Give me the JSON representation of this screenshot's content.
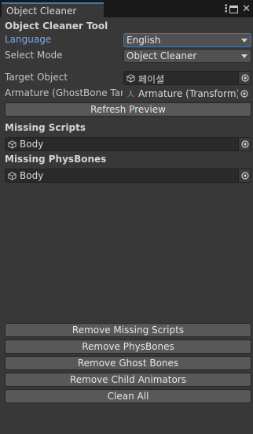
{
  "window": {
    "tab_title": "Object Cleaner",
    "icons": [
      "more-vertical-icon",
      "maximize-icon",
      "close-icon"
    ]
  },
  "header": {
    "title": "Object Cleaner Tool"
  },
  "language": {
    "label": "Language",
    "value": "English"
  },
  "mode": {
    "label": "Select Mode",
    "value": "Object Cleaner"
  },
  "target": {
    "label": "Target Object",
    "value": "페이셜"
  },
  "armature": {
    "label": "Armature (GhostBone Targ",
    "value": "Armature (Transform)"
  },
  "refresh_button": "Refresh Preview",
  "missing_scripts": {
    "title": "Missing Scripts",
    "items": [
      "Body"
    ]
  },
  "missing_physbones": {
    "title": "Missing PhysBones",
    "items": [
      "Body"
    ]
  },
  "actions": {
    "remove_missing_scripts": "Remove Missing Scripts",
    "remove_physbones": "Remove PhysBones",
    "remove_ghost_bones": "Remove Ghost Bones",
    "remove_child_animators": "Remove Child Animators",
    "clean_all": "Clean All"
  },
  "colors": {
    "background": "#383838",
    "tab_bar": "#191919",
    "accent": "#3a79bb",
    "link_label": "#7fa9e6"
  }
}
